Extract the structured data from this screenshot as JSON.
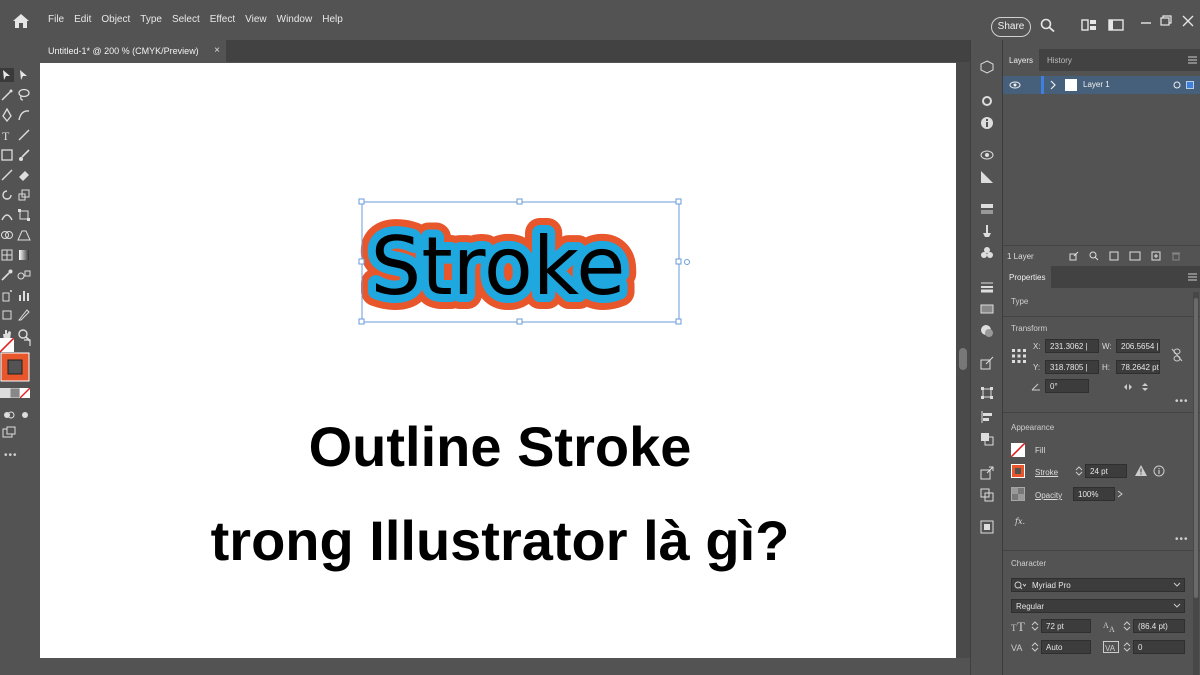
{
  "menubar": {
    "menus": [
      "File",
      "Edit",
      "Object",
      "Type",
      "Select",
      "Effect",
      "View",
      "Window",
      "Help"
    ],
    "share_label": "Share"
  },
  "document_tab": {
    "title": "Untitled-1* @ 200 % (CMYK/Preview)",
    "close": "×"
  },
  "artwork": {
    "stroke_text": "Stroke",
    "stroke_color": "#e8562c",
    "fill_color": "#1fa8e0"
  },
  "overlay": {
    "line1": "Outline Stroke",
    "line2": "trong Illustrator là gì?"
  },
  "layers_panel": {
    "tabs": [
      "Layers",
      "History"
    ],
    "layer_name": "Layer 1",
    "count_label": "1 Layer"
  },
  "properties_panel": {
    "tab": "Properties",
    "type_label": "Type",
    "transform_label": "Transform",
    "x_label": "X:",
    "x_value": "231.3062 |",
    "y_label": "Y:",
    "y_value": "318.7805 |",
    "w_label": "W:",
    "w_value": "206.5654 |",
    "h_label": "H:",
    "h_value": "78.2642 pt",
    "rotate_value": "0°",
    "appearance_label": "Appearance",
    "fill_label": "Fill",
    "stroke_label": "Stroke",
    "stroke_weight": "24 pt",
    "opacity_label": "Opacity",
    "opacity_value": "100%",
    "fx_label": "fx.",
    "character_label": "Character",
    "font_family": "Myriad Pro",
    "font_style": "Regular",
    "font_size": "72 pt",
    "leading": "(86.4 pt)",
    "kerning": "Auto",
    "tracking": "0"
  },
  "colors": {
    "accent_stroke_orange": "#e8562c",
    "fill_blue": "#1fa8e0",
    "selection_blue": "#6b9bd8"
  }
}
